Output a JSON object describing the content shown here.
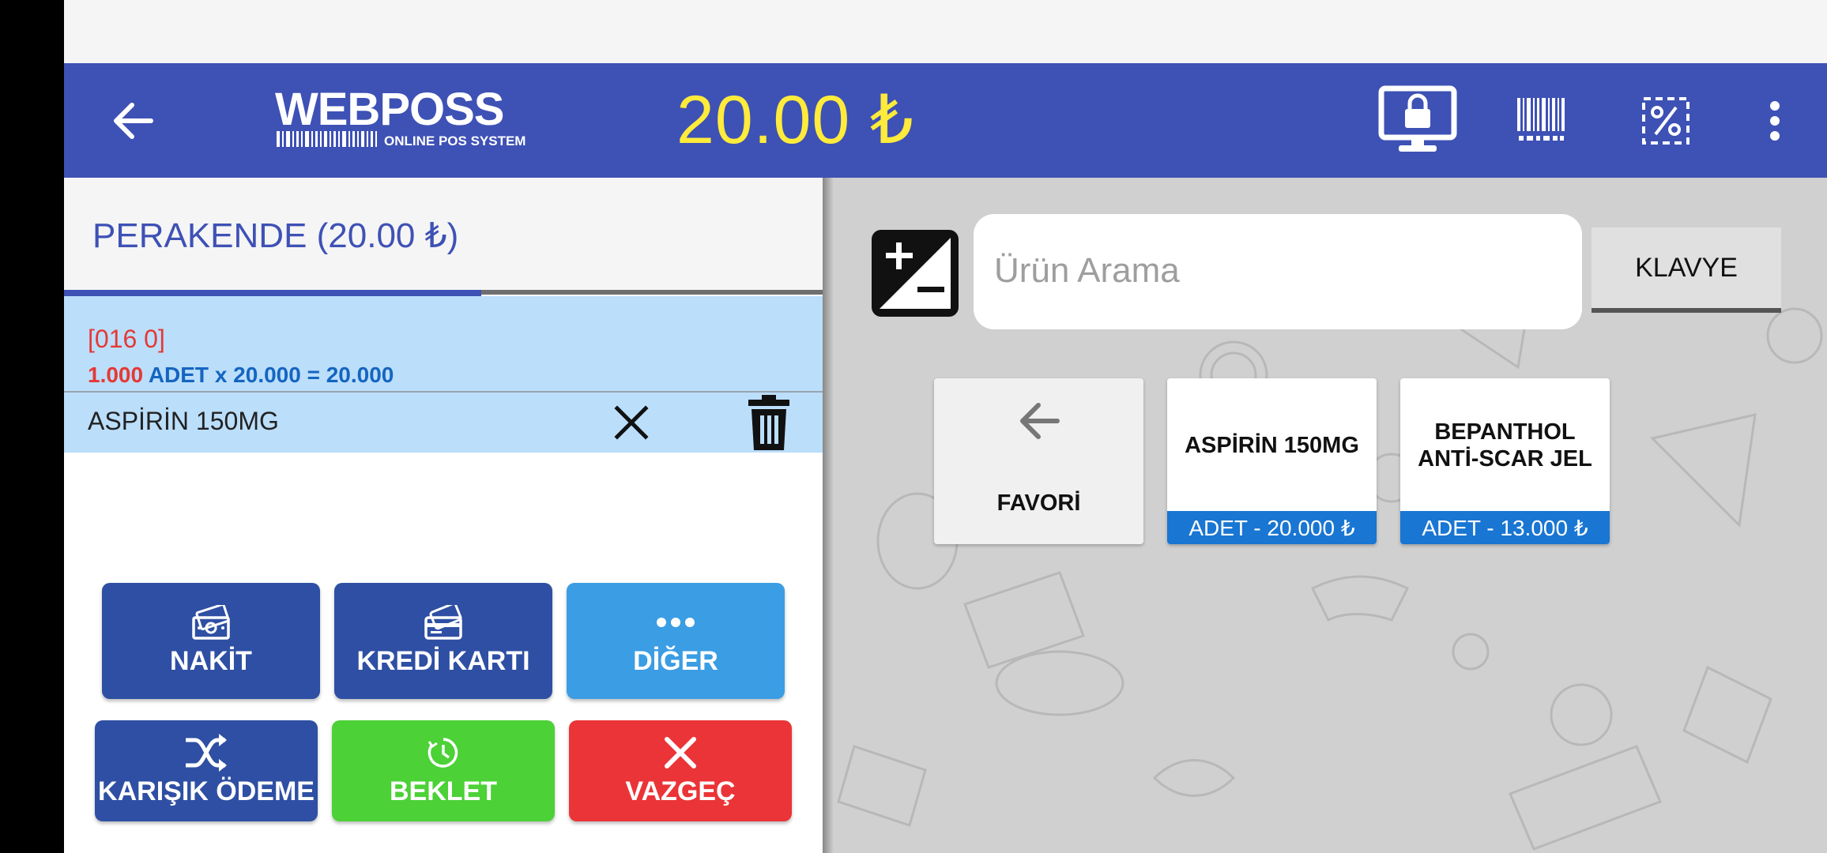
{
  "header": {
    "logo_main": "WEBPOSS",
    "logo_sub": "ONLINE POS SYSTEM",
    "total": "20.00 ₺",
    "icons": [
      "back-arrow-icon",
      "lock-monitor-icon",
      "barcode-icon",
      "discount-percent-icon",
      "more-vert-icon"
    ],
    "accent_color": "#3e51b5",
    "total_color": "#ffeb3b"
  },
  "customer": {
    "label": "PERAKENDE (20.00 ₺)"
  },
  "cart": {
    "items": [
      {
        "code": "[016 0]",
        "quantity": "1.000",
        "calculation": " ADET x 20.000 = 20.000",
        "name": "ASPİRİN 150MG"
      }
    ]
  },
  "payment_buttons": {
    "cash": "NAKİT",
    "credit_card": "KREDİ KARTI",
    "other": "DİĞER",
    "mixed": "KARIŞIK ÖDEME",
    "hold": "BEKLET",
    "cancel": "VAZGEÇ",
    "colors": {
      "primary": "#2e4fa3",
      "other": "#3b9de3",
      "hold": "#4cd137",
      "cancel": "#eb3437"
    }
  },
  "search": {
    "placeholder": "Ürün Arama",
    "keyboard_button": "KLAVYE"
  },
  "products": {
    "favorite_tile": "FAVORİ",
    "tiles": [
      {
        "name": "ASPİRİN 150MG",
        "price": "ADET - 20.000 ₺"
      },
      {
        "name_line1": "BEPANTHOL",
        "name_line2": "ANTİ-SCAR JEL",
        "price": "ADET - 13.000 ₺"
      }
    ],
    "price_bar_color": "#1976d2"
  }
}
